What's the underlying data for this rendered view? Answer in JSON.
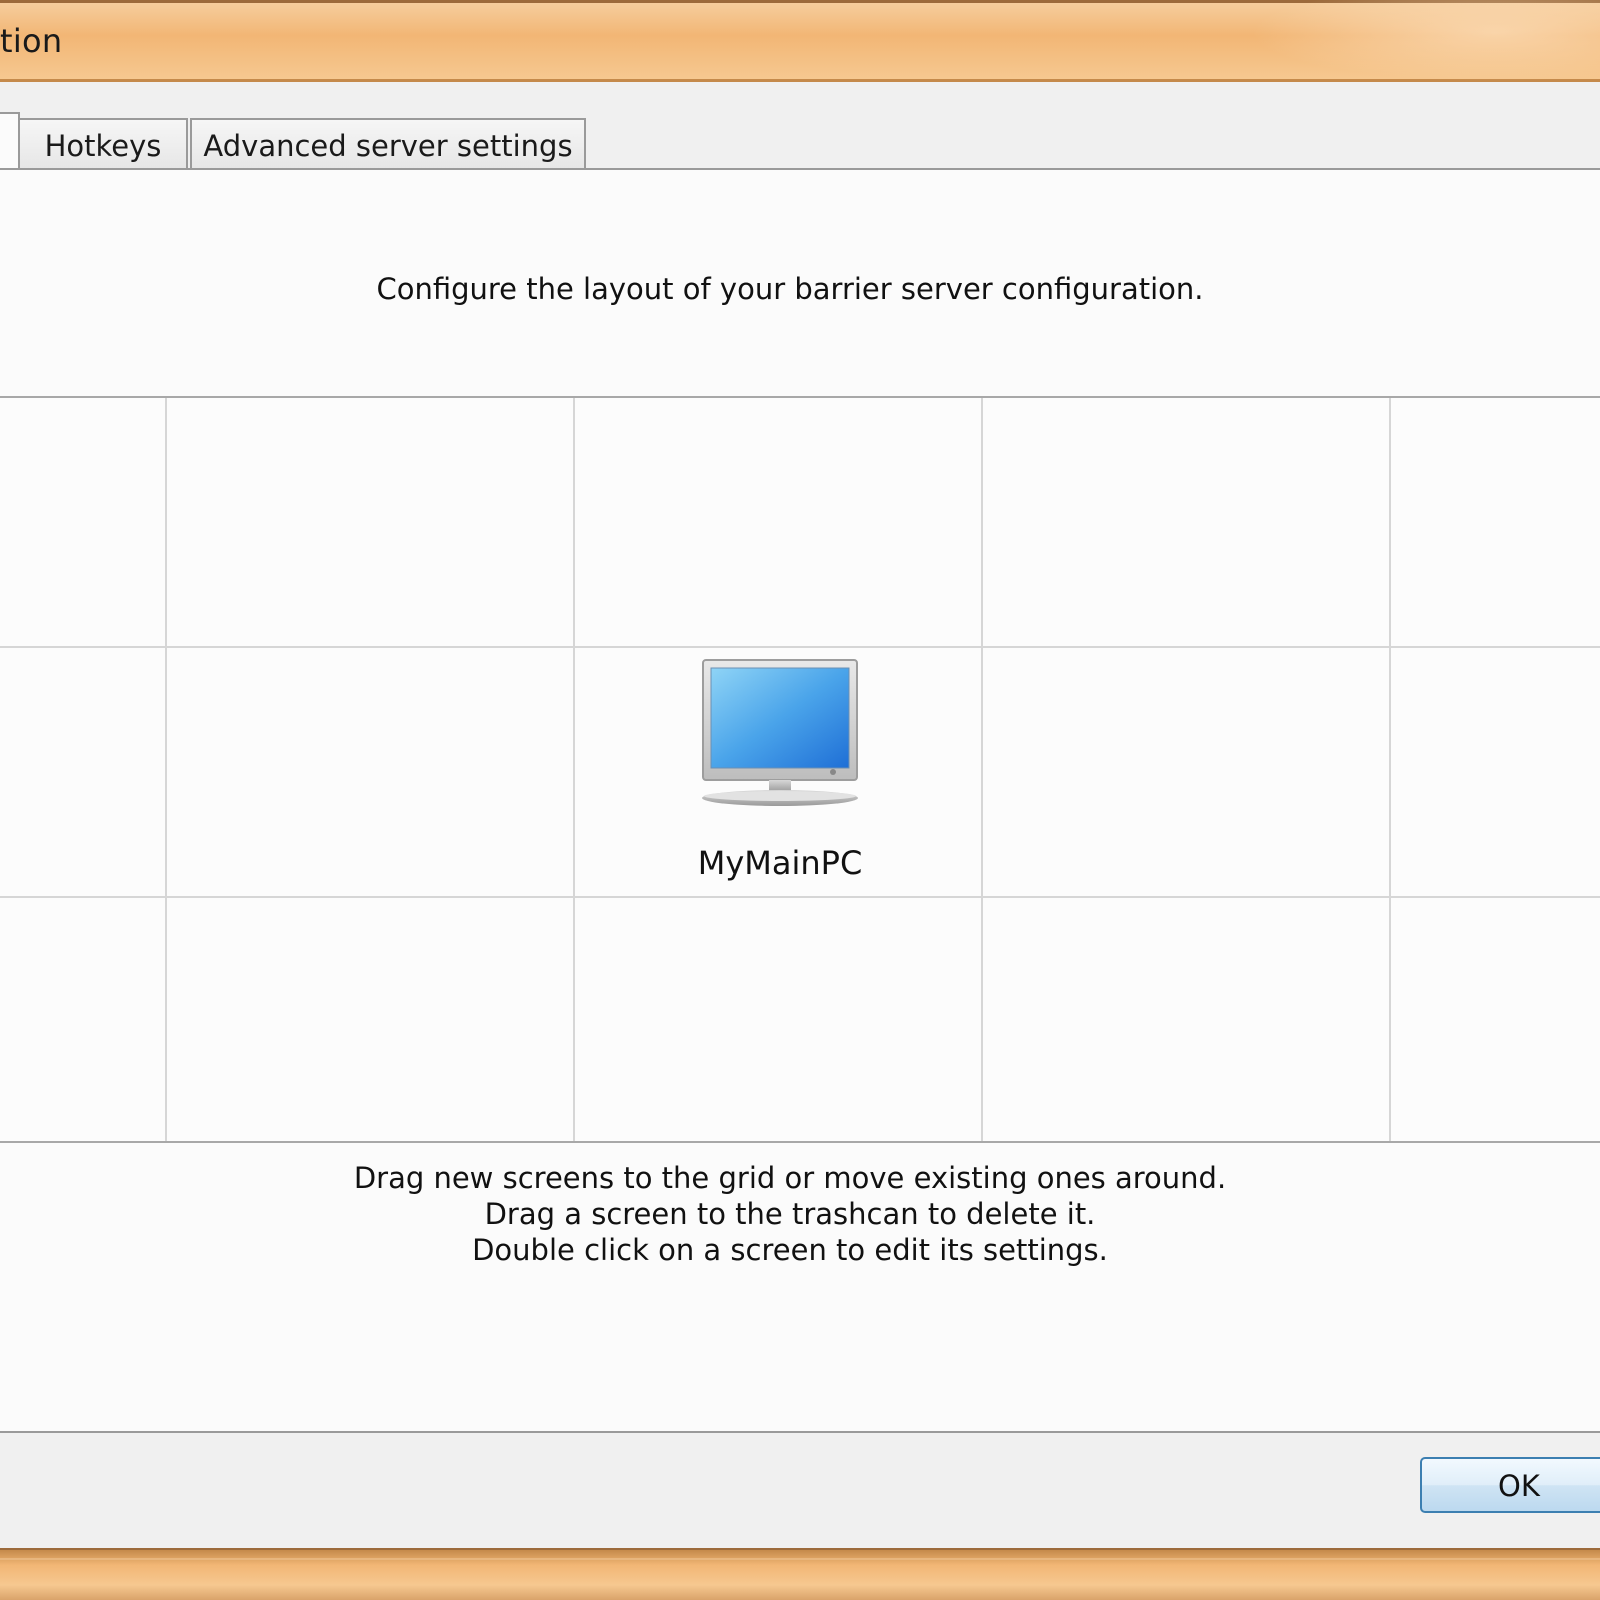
{
  "window": {
    "title_fragment": "tion"
  },
  "tabs": [
    {
      "label": "Hotkeys"
    },
    {
      "label": "Advanced server settings"
    }
  ],
  "layout_tab": {
    "intro": "Configure the layout of your barrier server configuration.",
    "screens": [
      {
        "name": "MyMainPC",
        "icon": "monitor-icon"
      }
    ],
    "help_lines": [
      "Drag new screens to the grid or move existing ones around.",
      "Drag a screen to the trashcan to delete it.",
      "Double click on a screen to edit its settings."
    ]
  },
  "buttons": {
    "ok_label": "OK"
  },
  "colors": {
    "title_bar": "#f2b675",
    "panel_background": "#fbfbfb",
    "grid_line": "#d6d6d6",
    "ok_border": "#3c7fb1",
    "monitor_screen": "#3d8fe3"
  }
}
